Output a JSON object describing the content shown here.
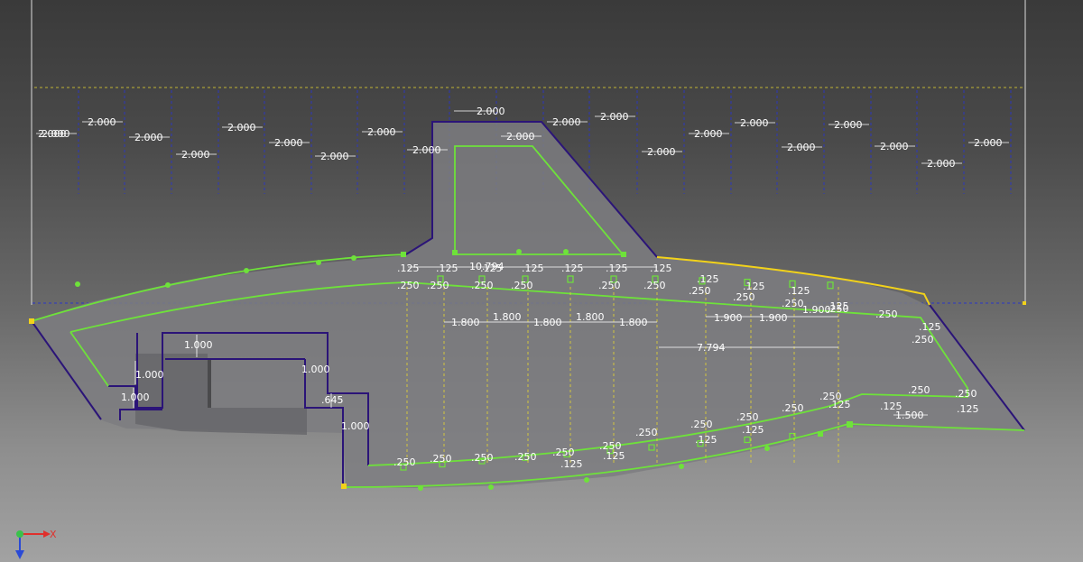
{
  "viewport": {
    "background_top": "#3a3a3a",
    "background_bottom": "#a2a2a2"
  },
  "colors": {
    "sketch_profile": "#2b1478",
    "constrained_geometry": "#6ee23a",
    "projected_edge": "#f2d21a",
    "construction_line": "#2a36c8",
    "reference_line": "#e8d830",
    "dimension": "#ffffff"
  },
  "top_spacing_dims": [
    "2.000",
    "2.000",
    "2.000",
    "2.000",
    "2.000",
    "2.000",
    "2.000",
    "2.000",
    "2.000",
    "2.000",
    "2.000",
    "2.000",
    "2.000",
    "2.000",
    "2.000",
    "2.000",
    "2.000",
    "2.000",
    "2.000",
    "2.000",
    "2.000",
    "2.000"
  ],
  "row_dims": {
    "overall": "10.794",
    "tabs_125": [
      ".125",
      ".125",
      ".125",
      ".125",
      ".125",
      ".125",
      ".125"
    ],
    "tabs_250": [
      ".250",
      ".250",
      ".250",
      ".250",
      ".250",
      ".250"
    ],
    "spacing_1800": [
      "1.800",
      "1.800",
      "1.800",
      "1.800",
      "1.800"
    ],
    "spacing_1900": [
      "1.900",
      "1.900",
      "1.900"
    ],
    "right_span": "7.794",
    "right_125": [
      ".125",
      ".125",
      ".125",
      ".125",
      ".125"
    ],
    "right_250": [
      ".250",
      ".250",
      ".250",
      ".250",
      ".250",
      ".250"
    ]
  },
  "left_dims": {
    "d1": "1.000",
    "d2": "1.000",
    "d3": "1.000",
    "d4": "1.000",
    "d5": ".645",
    "d6": "1.000"
  },
  "bottom_dims": {
    "labels_250": [
      ".250",
      ".250",
      ".250",
      ".250",
      ".250",
      ".250",
      ".250",
      ".250",
      ".250",
      ".250",
      ".250",
      ".250"
    ],
    "labels_125": [
      ".125",
      ".125",
      ".125",
      ".125",
      ".125",
      ".125"
    ],
    "right_1500": "1.500",
    "right_125": ".125",
    "right_250": ".250"
  },
  "axis_triad": {
    "x_label": "X"
  }
}
